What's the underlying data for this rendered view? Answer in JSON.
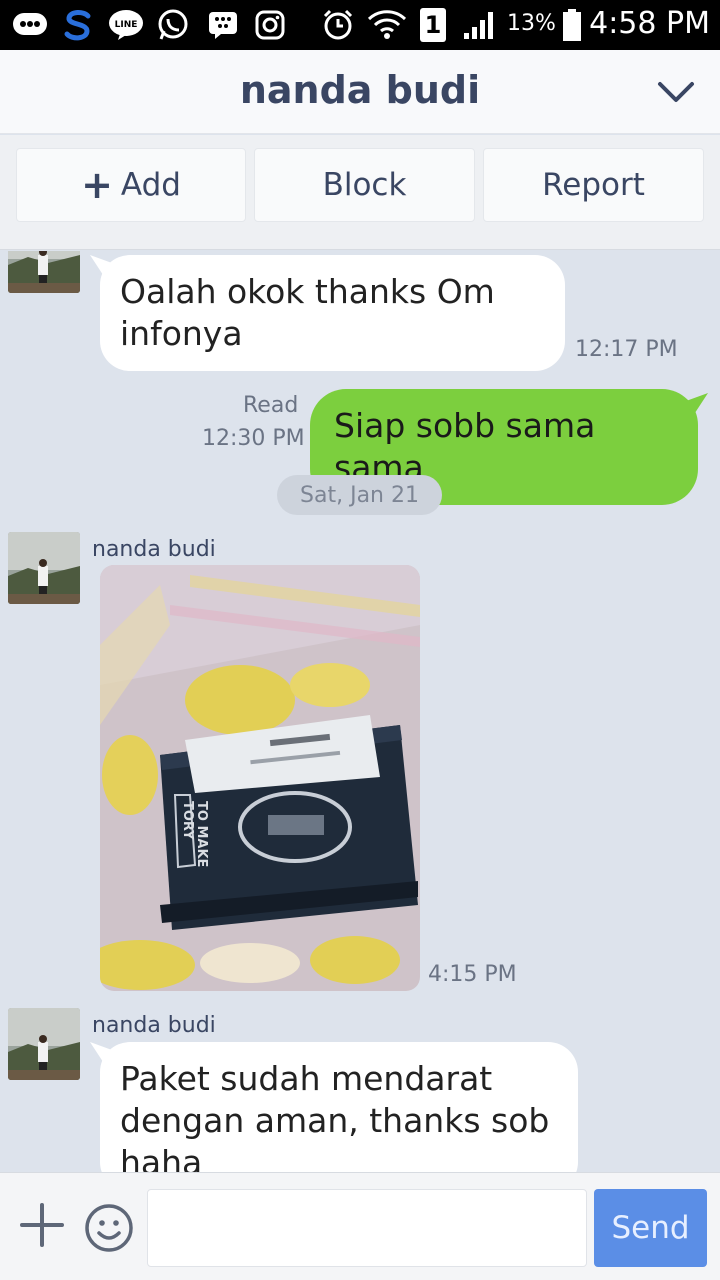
{
  "status_bar": {
    "icons": [
      "chat-bubble-icon",
      "s-app-icon",
      "line-icon",
      "whatsapp-icon",
      "bbm-icon",
      "instagram-icon",
      "alarm-icon",
      "wifi-icon",
      "sim-1-icon",
      "signal-icon",
      "battery-icon"
    ],
    "sim_label": "1",
    "battery": "13%",
    "time": "4:58 PM"
  },
  "header": {
    "title": "nanda budi",
    "chevron_icon": "chevron-down-icon"
  },
  "actions": {
    "add_label": "Add",
    "block_label": "Block",
    "report_label": "Report"
  },
  "messages": [
    {
      "text": "Oalah okok thanks Om infonya",
      "time": "12:17 PM"
    },
    {
      "status": "Read",
      "time": "12:30 PM",
      "text": "Siap sobb sama sama"
    },
    {
      "date": "Sat, Jan 21"
    },
    {
      "sender": "nanda budi",
      "time": "4:15 PM"
    },
    {
      "sender": "nanda budi",
      "text": "Paket sudah mendarat dengan aman, thanks sob haha"
    }
  ],
  "photo_text": [
    "TO MAKE",
    "TORY"
  ],
  "input": {
    "placeholder": "",
    "send_label": "Send"
  },
  "colors": {
    "outgoing_bubble": "#7ccf3e",
    "incoming_bubble": "#ffffff",
    "chat_background": "#dde3ec",
    "send_button": "#5b8ee6",
    "header_text": "#3a4663"
  }
}
